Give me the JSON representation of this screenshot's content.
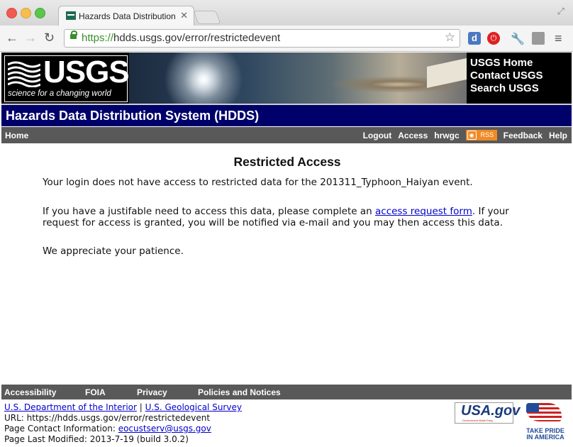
{
  "browser": {
    "tab_title": "Hazards Data Distribution",
    "tab_close": "✕",
    "url_scheme": "https://",
    "url_rest": "hdds.usgs.gov/error/restrictedevent",
    "ext_labels": [
      "d",
      "⏻"
    ]
  },
  "header": {
    "logo_text": "USGS",
    "logo_tagline": "science for a changing world",
    "links": [
      "USGS Home",
      "Contact USGS",
      "Search USGS"
    ],
    "system_title": "Hazards Data Distribution System (HDDS)"
  },
  "nav": {
    "home": "Home",
    "logout": "Logout",
    "access": "Access",
    "user": "hrwgc",
    "rss": "RSS",
    "feedback": "Feedback",
    "help": "Help"
  },
  "main": {
    "title": "Restricted Access",
    "p1": "Your login does not have access to restricted data for the 201311_Typhoon_Haiyan event.",
    "p2_before": "If you have a justifable need to access this data, please complete an ",
    "p2_link": "access request form",
    "p2_after": ". If your request for access is granted, you will be notified via e-mail and you may then access this data.",
    "p3": "We appreciate your patience."
  },
  "footer": {
    "links": [
      "Accessibility",
      "FOIA",
      "Privacy",
      "Policies and Notices"
    ],
    "doi": "U.S. Department of the Interior",
    "separator": " | ",
    "usgs": "U.S. Geological Survey",
    "url_line": "URL: https://hdds.usgs.gov/error/restrictedevent",
    "contact_label": "Page Contact Information: ",
    "contact_email": "eocustserv@usgs.gov",
    "modified": "Page Last Modified: 2013-7-19 (build 3.0.2)",
    "usagov": "USA.gov",
    "usagov_sub": "Government Made Easy",
    "tpia": "TAKE PRIDE IN AMERICA"
  }
}
